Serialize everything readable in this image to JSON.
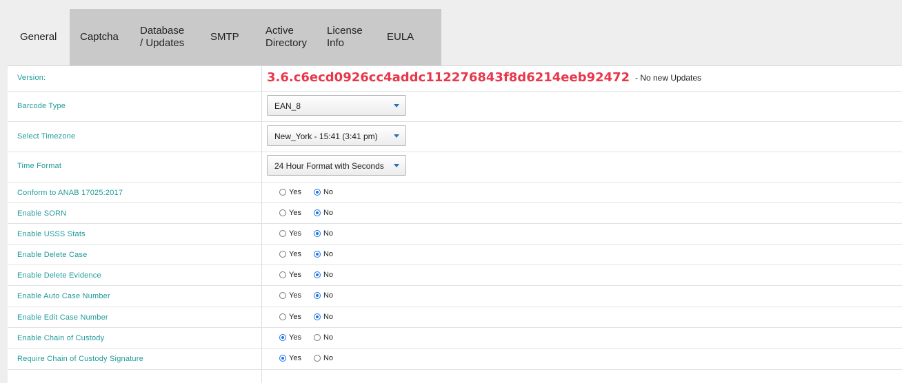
{
  "tabs": [
    {
      "label": "General",
      "active": true
    },
    {
      "label": "Captcha",
      "active": false
    },
    {
      "label": "Database / Updates",
      "active": false
    },
    {
      "label": "SMTP",
      "active": false
    },
    {
      "label": "Active Directory",
      "active": false
    },
    {
      "label": "License Info",
      "active": false
    },
    {
      "label": "EULA",
      "active": false
    }
  ],
  "version": {
    "label": "Version:",
    "value": "3.6.c6ecd0926cc4addc112276843f8d6214eeb92472",
    "note": "- No new Updates",
    "value_color": "#e8374a"
  },
  "selects": {
    "barcode": {
      "label": "Barcode Type",
      "value": "EAN_8"
    },
    "timezone": {
      "label": "Select Timezone",
      "value": "New_York - 15:41 (3:41 pm)"
    },
    "time_format": {
      "label": "Time Format",
      "value": "24 Hour Format with Seconds"
    }
  },
  "radio_options": {
    "yes": "Yes",
    "no": "No"
  },
  "toggles": [
    {
      "label": "Conform to ANAB 17025:2017",
      "value": "no"
    },
    {
      "label": "Enable SORN",
      "value": "no"
    },
    {
      "label": "Enable USSS Stats",
      "value": "no"
    },
    {
      "label": "Enable Delete Case",
      "value": "no"
    },
    {
      "label": "Enable Delete Evidence",
      "value": "no"
    },
    {
      "label": "Enable Auto Case Number",
      "value": "no"
    },
    {
      "label": "Enable Edit Case Number",
      "value": "no"
    },
    {
      "label": "Enable Chain of Custody",
      "value": "yes"
    },
    {
      "label": "Require Chain of Custody Signature",
      "value": "yes"
    }
  ],
  "colors": {
    "label": "#1f9a9a",
    "accent": "#1a73e8"
  }
}
